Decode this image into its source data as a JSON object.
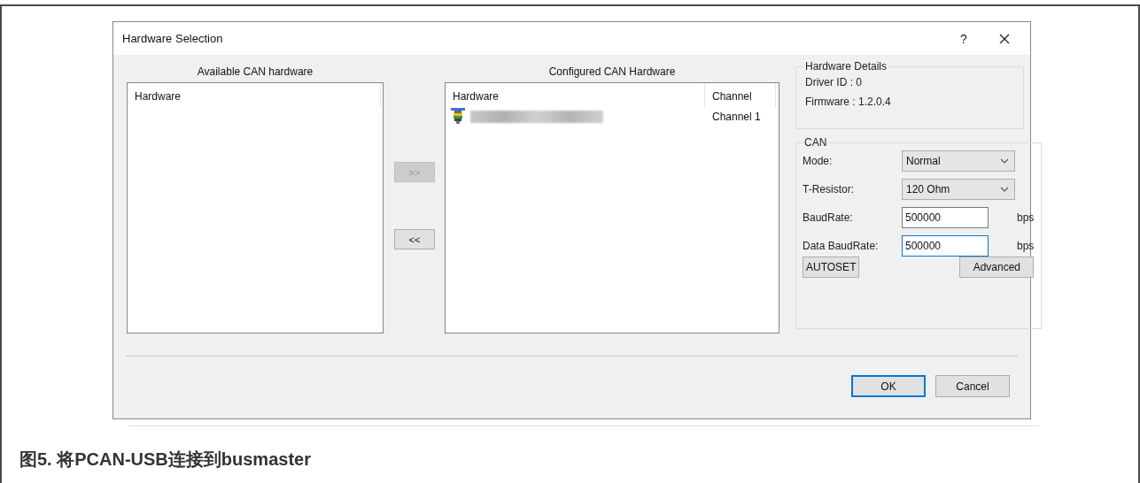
{
  "window": {
    "title": "Hardware Selection",
    "help": "?"
  },
  "available": {
    "heading": "Available CAN hardware",
    "columns": [
      "Hardware"
    ]
  },
  "transfer_buttons": [
    {
      "label": ">>",
      "disabled": true
    },
    {
      "label": "<<",
      "disabled": false
    }
  ],
  "configured": {
    "heading": "Configured CAN Hardware",
    "columns": [
      "Hardware",
      "Channel"
    ],
    "rows": [
      {
        "channel": "Channel 1"
      }
    ]
  },
  "details": {
    "title": "Hardware Details",
    "lines": [
      "Driver ID : 0",
      "Firmware :  1.2.0.4"
    ]
  },
  "can": {
    "title": "CAN",
    "fields": [
      {
        "kind": "dropdown",
        "label": "Mode:",
        "value": "Normal"
      },
      {
        "kind": "dropdown",
        "label": "T-Resistor:",
        "value": "120 Ohm"
      },
      {
        "kind": "text",
        "label": "BaudRate:",
        "value": "500000",
        "unit": "bps",
        "focused": false
      },
      {
        "kind": "text",
        "label": "Data BaudRate:",
        "value": "500000",
        "unit": "bps",
        "focused": true
      }
    ],
    "buttons": [
      "AUTOSET",
      "Advanced"
    ]
  },
  "footer_buttons": [
    {
      "label": "OK",
      "default": true
    },
    {
      "label": "Cancel",
      "default": false
    }
  ],
  "caption": "图5. 将PCAN-USB连接到busmaster"
}
